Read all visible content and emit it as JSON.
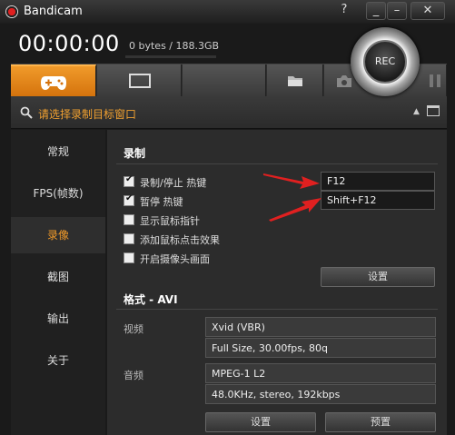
{
  "window": {
    "title": "Bandicam",
    "help": "?",
    "minimize": "_",
    "restore": "–",
    "close": "✕"
  },
  "header": {
    "timer": "00:00:00",
    "storage": "0 bytes / 188.3GB",
    "rec_label": "REC"
  },
  "tabs": [
    {
      "name": "game-mode",
      "icon": "gamepad-icon",
      "active": true
    },
    {
      "name": "screen-mode",
      "icon": "screen-icon",
      "active": false
    },
    {
      "name": "empty",
      "icon": "",
      "active": false
    },
    {
      "name": "open-folder",
      "icon": "folder-icon",
      "active": false
    },
    {
      "name": "screenshot",
      "icon": "camera-icon",
      "active": false
    },
    {
      "name": "pause",
      "icon": "pause-icon",
      "active": false
    }
  ],
  "target_bar": {
    "text": "请选择录制目标窗口",
    "icon": "search-icon"
  },
  "sidebar": {
    "items": [
      {
        "label": "常规"
      },
      {
        "label": "FPS(帧数)"
      },
      {
        "label": "录像",
        "active": true
      },
      {
        "label": "截图"
      },
      {
        "label": "输出"
      },
      {
        "label": "关于"
      }
    ]
  },
  "record": {
    "title": "录制",
    "options": [
      {
        "label": "录制/停止 热键",
        "checked": true
      },
      {
        "label": "暂停 热键",
        "checked": true
      },
      {
        "label": "显示鼠标指针",
        "checked": false
      },
      {
        "label": "添加鼠标点击效果",
        "checked": false
      },
      {
        "label": "开启摄像头画面",
        "checked": false
      }
    ],
    "hotkey_record": "F12",
    "hotkey_pause": "Shift+F12",
    "settings_button": "设置"
  },
  "format": {
    "title": "格式 - AVI",
    "video_label": "视频",
    "video_codec": "Xvid (VBR)",
    "video_detail": "Full Size, 30.00fps, 80q",
    "audio_label": "音频",
    "audio_codec": "MPEG-1 L2",
    "audio_detail": "48.0KHz, stereo, 192kbps",
    "settings_button": "设置",
    "preset_button": "预置"
  },
  "colors": {
    "accent": "#f09a2a",
    "arrow": "#e02020"
  }
}
